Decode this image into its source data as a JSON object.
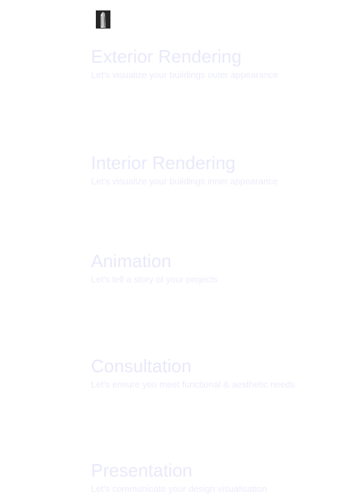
{
  "logo": {
    "icon": "building-tower-icon"
  },
  "services": [
    {
      "title": "Exterior Rendering",
      "subtitle": "Let's visualize your buildings outer appearance"
    },
    {
      "title": "Interior Rendering",
      "subtitle": "Let's visualize your buildings inner appearance"
    },
    {
      "title": "Animation",
      "subtitle": "Let's tell a story of your projects"
    },
    {
      "title": "Consultation",
      "subtitle": "Let's ensure you meet functional & aesthetic needs"
    },
    {
      "title": "Presentation",
      "subtitle": "Let's communicate your design visualisation"
    }
  ],
  "colors": {
    "title": "#e9e9fb",
    "subtitle": "#ececfb",
    "logo_bg": "#2a2a2a"
  }
}
